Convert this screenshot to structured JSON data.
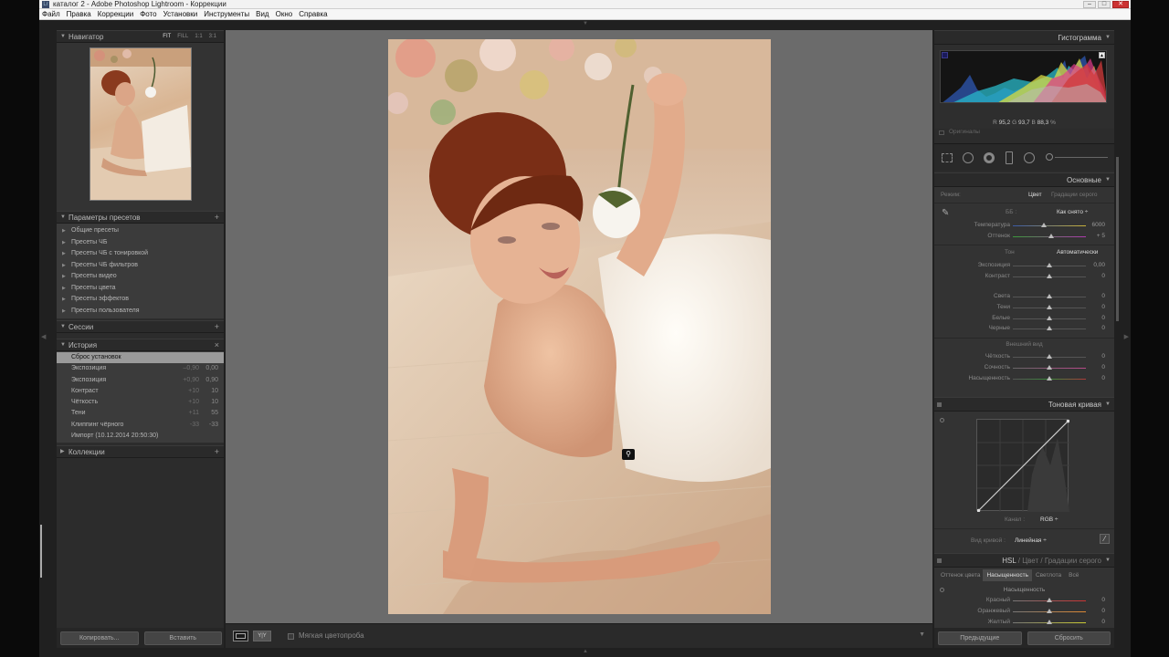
{
  "window": {
    "title": "каталог 2 - Adobe Photoshop Lightroom - Коррекции",
    "app_icon": "Lr",
    "btns": [
      "–",
      "□",
      "✕"
    ]
  },
  "menu": [
    "Файл",
    "Правка",
    "Коррекции",
    "Фото",
    "Установки",
    "Инструменты",
    "Вид",
    "Окно",
    "Справка"
  ],
  "left": {
    "navigator": {
      "title": "Навигатор",
      "zooms": [
        "FIT",
        "FILL",
        "1:1",
        "3:1"
      ]
    },
    "presets": {
      "title": "Параметры пресетов",
      "items": [
        "Общие пресеты",
        "Пресеты ЧБ",
        "Пресеты ЧБ с тонировкой",
        "Пресеты ЧБ фильтров",
        "Пресеты видео",
        "Пресеты цвета",
        "Пресеты эффектов",
        "Пресеты пользователя"
      ]
    },
    "sessions": {
      "title": "Сессии"
    },
    "history": {
      "title": "История",
      "close": "×",
      "items": [
        {
          "label": "Сброс установок",
          "v1": "",
          "v2": ""
        },
        {
          "label": "Экспозиция",
          "v1": "–0,90",
          "v2": "0,00"
        },
        {
          "label": "Экспозиция",
          "v1": "+0,90",
          "v2": "0,90"
        },
        {
          "label": "Контраст",
          "v1": "+10",
          "v2": "10"
        },
        {
          "label": "Чёткость",
          "v1": "+10",
          "v2": "10"
        },
        {
          "label": "Тени",
          "v1": "+11",
          "v2": "55"
        },
        {
          "label": "Клиппинг чёрного",
          "v1": "-33",
          "v2": "-33"
        },
        {
          "label": "Импорт (10.12.2014 20:50:30)",
          "v1": "",
          "v2": ""
        }
      ]
    },
    "collections": {
      "title": "Коллекции"
    },
    "copy_btn": "Копировать...",
    "paste_btn": "Вставить"
  },
  "toolbar": {
    "softproof_label": "Мягкая цветопроба"
  },
  "right": {
    "histogram": {
      "title": "Гистограмма",
      "r_label": "R",
      "r": "95,2",
      "g_label": "G",
      "g": "93,7",
      "b_label": "B",
      "b": "88,3",
      "unit": "%",
      "originals": "Оригиналы"
    },
    "basic": {
      "title": "Основные",
      "mode_label": "Режим:",
      "mode_color": "Цвет",
      "mode_gray": "Градации серого",
      "wb_label": "ББ :",
      "wb_value": "Как снято ÷",
      "temp": {
        "label": "Температура",
        "value": "6000",
        "pos": 0.42
      },
      "tint": {
        "label": "Оттенок",
        "value": "+ 5",
        "pos": 0.53
      },
      "tone_label": "Тон",
      "auto_label": "Автоматически",
      "tone": [
        {
          "label": "Экспозиция",
          "value": "0,00",
          "pos": 0.5
        },
        {
          "label": "Контраст",
          "value": "0",
          "pos": 0.5
        }
      ],
      "tone2": [
        {
          "label": "Света",
          "value": "0",
          "pos": 0.5
        },
        {
          "label": "Тени",
          "value": "0",
          "pos": 0.5
        },
        {
          "label": "Белые",
          "value": "0",
          "pos": 0.5
        },
        {
          "label": "Черные",
          "value": "0",
          "pos": 0.5
        }
      ],
      "presence_label": "Внешний вид",
      "presence": [
        {
          "label": "Чёткость",
          "value": "0",
          "pos": 0.5
        },
        {
          "label": "Сочность",
          "value": "0",
          "pos": 0.5
        },
        {
          "label": "Насыщенность",
          "value": "0",
          "pos": 0.5
        }
      ]
    },
    "tonecurve": {
      "title": "Тоновая кривая",
      "channel_label": "Канал :",
      "channel_value": "RGB ÷",
      "curve_label": "Вид кривой :",
      "curve_value": "Линейная ÷"
    },
    "hsl": {
      "title_hsl": "HSL",
      "title_color": "Цвет",
      "title_gray": "Градации серого",
      "tabs": [
        "Оттенок цвета",
        "Насыщенность",
        "Светлота",
        "Всё"
      ],
      "active_tab": 1,
      "section": "Насыщенность",
      "items": [
        {
          "label": "Красный",
          "value": "0"
        },
        {
          "label": "Оранжевый",
          "value": "0"
        },
        {
          "label": "Желтый",
          "value": "0"
        }
      ]
    },
    "prev_btn": "Предыдущие",
    "reset_btn": "Сбросить"
  }
}
